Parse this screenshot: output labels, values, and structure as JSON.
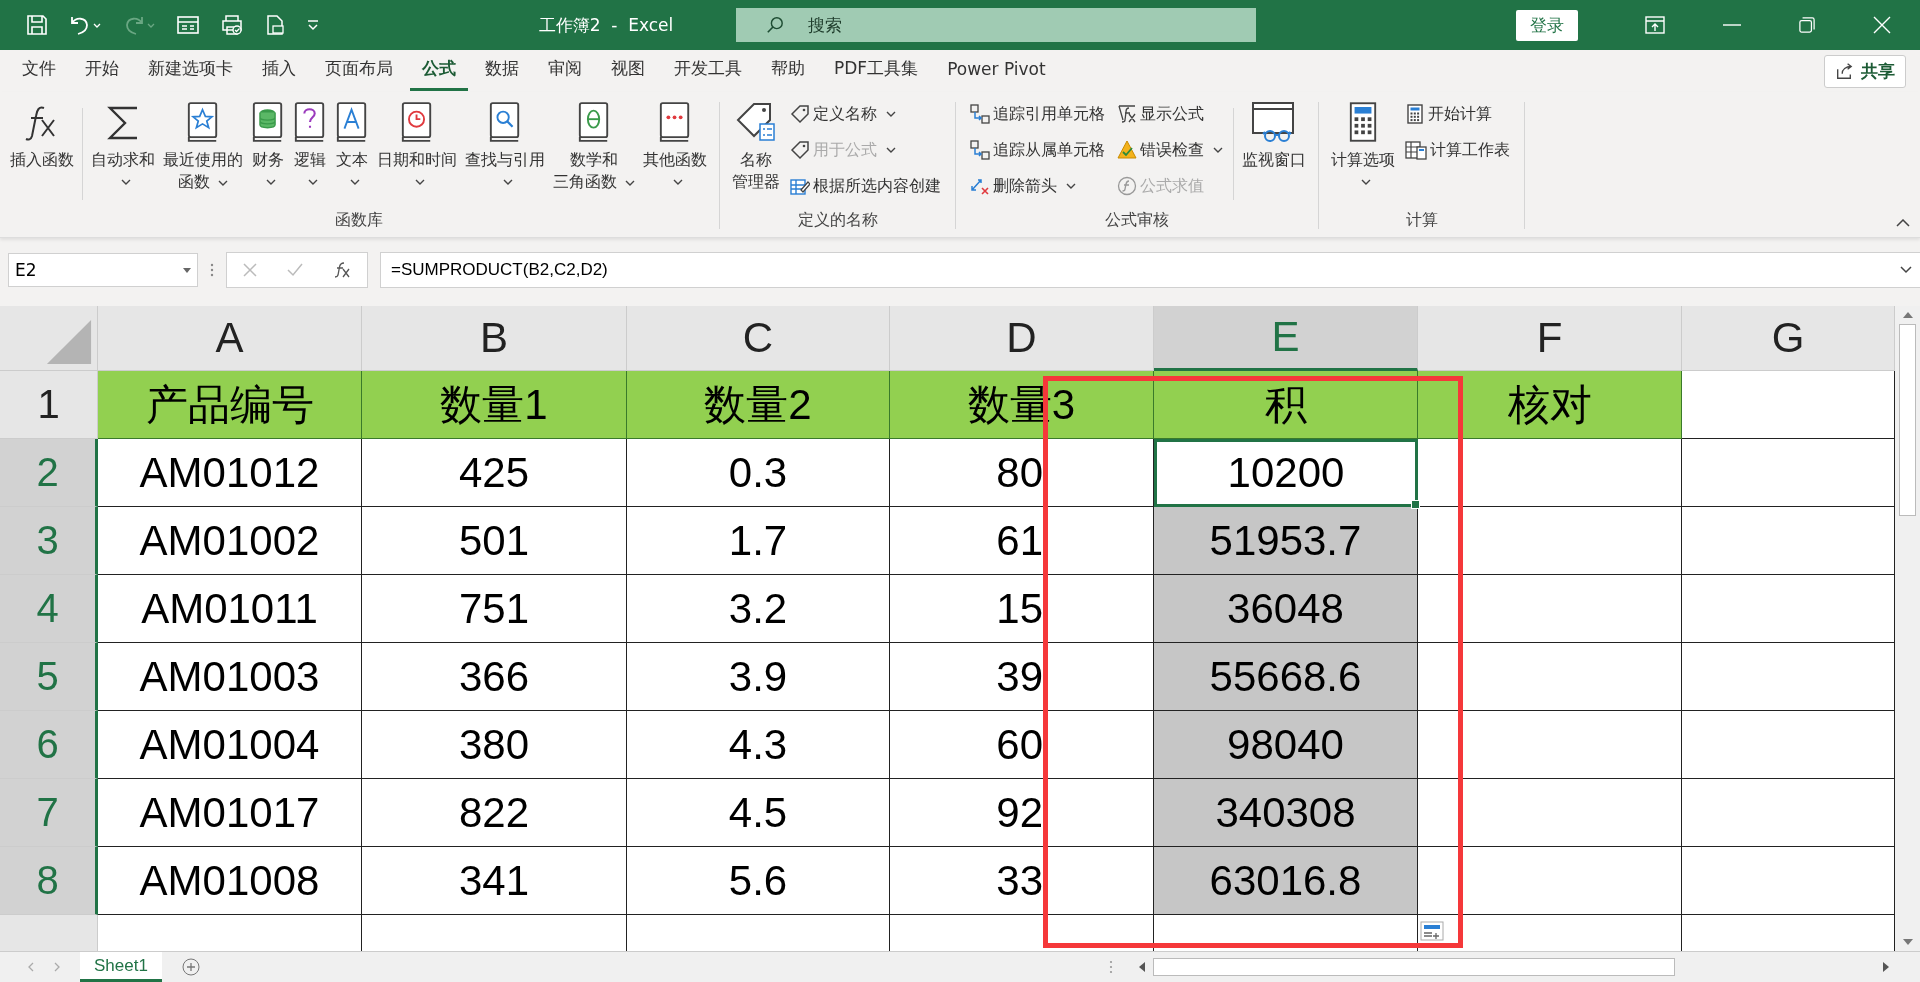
{
  "title_bar": {
    "title": "工作簿2  -  Excel",
    "search": {
      "placeholder": "搜索"
    },
    "sign_in": "登录"
  },
  "menu_tabs": [
    {
      "label": "文件",
      "selected": false
    },
    {
      "label": "开始",
      "selected": false
    },
    {
      "label": "新建选项卡",
      "selected": false
    },
    {
      "label": "插入",
      "selected": false
    },
    {
      "label": "页面布局",
      "selected": false
    },
    {
      "label": "公式",
      "selected": true
    },
    {
      "label": "数据",
      "selected": false
    },
    {
      "label": "审阅",
      "selected": false
    },
    {
      "label": "视图",
      "selected": false
    },
    {
      "label": "开发工具",
      "selected": false
    },
    {
      "label": "帮助",
      "selected": false
    },
    {
      "label": "PDF工具集",
      "selected": false
    },
    {
      "label": "Power Pivot",
      "selected": false
    }
  ],
  "share": "共享",
  "ribbon_groups": [
    {
      "label": "函数库",
      "columns": [
        {
          "kind": "large",
          "items": [
            {
              "lines": [
                "插入函数"
              ],
              "dropdown": false,
              "disabled": false
            }
          ]
        },
        {
          "kind": "separator"
        },
        {
          "kind": "large",
          "items": [
            {
              "lines": [
                "自动求和"
              ],
              "dropdown": true,
              "disabled": false
            }
          ]
        },
        {
          "kind": "large",
          "items": [
            {
              "lines": [
                "最近使用的",
                "函数"
              ],
              "dropdown": true,
              "disabled": false
            }
          ]
        },
        {
          "kind": "large",
          "items": [
            {
              "lines": [
                "财务"
              ],
              "dropdown": true,
              "disabled": false
            }
          ]
        },
        {
          "kind": "large",
          "items": [
            {
              "lines": [
                "逻辑"
              ],
              "dropdown": true,
              "disabled": false
            }
          ]
        },
        {
          "kind": "large",
          "items": [
            {
              "lines": [
                "文本"
              ],
              "dropdown": true,
              "disabled": false
            }
          ]
        },
        {
          "kind": "large",
          "items": [
            {
              "lines": [
                "日期和时间"
              ],
              "dropdown": true,
              "disabled": false
            }
          ]
        },
        {
          "kind": "large",
          "items": [
            {
              "lines": [
                "查找与引用"
              ],
              "dropdown": true,
              "disabled": false
            }
          ]
        },
        {
          "kind": "large",
          "items": [
            {
              "lines": [
                "数学和",
                "三角函数"
              ],
              "dropdown": true,
              "disabled": false
            }
          ]
        },
        {
          "kind": "large",
          "items": [
            {
              "lines": [
                "其他函数"
              ],
              "dropdown": true,
              "disabled": false
            }
          ]
        }
      ]
    },
    {
      "label": "定义的名称",
      "columns": [
        {
          "kind": "large",
          "items": [
            {
              "lines": [
                "名称",
                "管理器"
              ],
              "dropdown": false,
              "disabled": false
            }
          ]
        },
        {
          "kind": "small",
          "items": [
            {
              "lines": [
                "定义名称"
              ],
              "dropdown": true,
              "disabled": false
            },
            {
              "lines": [
                "用于公式"
              ],
              "dropdown": true,
              "disabled": true
            },
            {
              "lines": [
                "根据所选内容创建"
              ],
              "dropdown": false,
              "disabled": false
            }
          ]
        }
      ]
    },
    {
      "label": "公式审核",
      "columns": [
        {
          "kind": "small",
          "items": [
            {
              "lines": [
                "追踪引用单元格"
              ],
              "dropdown": false,
              "disabled": false
            },
            {
              "lines": [
                "追踪从属单元格"
              ],
              "dropdown": false,
              "disabled": false
            },
            {
              "lines": [
                "删除箭头"
              ],
              "dropdown": true,
              "disabled": false
            }
          ]
        },
        {
          "kind": "small",
          "items": [
            {
              "lines": [
                "显示公式"
              ],
              "dropdown": false,
              "disabled": false
            },
            {
              "lines": [
                "错误检查"
              ],
              "dropdown": true,
              "disabled": false
            },
            {
              "lines": [
                "公式求值"
              ],
              "dropdown": false,
              "disabled": true
            }
          ]
        },
        {
          "kind": "separator"
        },
        {
          "kind": "large",
          "items": [
            {
              "lines": [
                "监视窗口"
              ],
              "dropdown": false,
              "disabled": false
            }
          ]
        }
      ]
    },
    {
      "label": "计算",
      "columns": [
        {
          "kind": "large",
          "items": [
            {
              "lines": [
                "计算选项"
              ],
              "dropdown": true,
              "disabled": false
            }
          ]
        },
        {
          "kind": "small",
          "items": [
            {
              "lines": [
                "开始计算"
              ],
              "dropdown": false,
              "disabled": false
            },
            {
              "lines": [
                "计算工作表"
              ],
              "dropdown": false,
              "disabled": false
            }
          ]
        }
      ]
    }
  ],
  "formula_bar": {
    "name_box": "E2",
    "formula": "=SUMPRODUCT(B2,C2,D2)"
  },
  "columns": [
    {
      "label": "A",
      "selected": false
    },
    {
      "label": "B",
      "selected": false
    },
    {
      "label": "C",
      "selected": false
    },
    {
      "label": "D",
      "selected": false
    },
    {
      "label": "E",
      "selected": true
    },
    {
      "label": "F",
      "selected": false
    },
    {
      "label": "G",
      "selected": false
    }
  ],
  "rows": [
    {
      "number": "1",
      "kind": "header",
      "selected": false,
      "active": false,
      "cells": [
        "产品编号",
        "数量1",
        "数量2",
        "数量3",
        "积",
        "核对"
      ]
    },
    {
      "number": "2",
      "kind": "data",
      "selected": true,
      "active": true,
      "cells": [
        "AM01012",
        "425",
        "0.3",
        "80",
        "10200"
      ]
    },
    {
      "number": "3",
      "kind": "data",
      "selected": true,
      "active": false,
      "cells": [
        "AM01002",
        "501",
        "1.7",
        "61",
        "51953.7"
      ]
    },
    {
      "number": "4",
      "kind": "data",
      "selected": true,
      "active": false,
      "cells": [
        "AM01011",
        "751",
        "3.2",
        "15",
        "36048"
      ]
    },
    {
      "number": "5",
      "kind": "data",
      "selected": true,
      "active": false,
      "cells": [
        "AM01003",
        "366",
        "3.9",
        "39",
        "55668.6"
      ]
    },
    {
      "number": "6",
      "kind": "data",
      "selected": true,
      "active": false,
      "cells": [
        "AM01004",
        "380",
        "4.3",
        "60",
        "98040"
      ]
    },
    {
      "number": "7",
      "kind": "data",
      "selected": true,
      "active": false,
      "cells": [
        "AM01017",
        "822",
        "4.5",
        "92",
        "340308"
      ]
    },
    {
      "number": "8",
      "kind": "data",
      "selected": true,
      "active": false,
      "cells": [
        "AM01008",
        "341",
        "5.6",
        "33",
        "63016.8"
      ]
    }
  ],
  "sheet_tabs": [
    {
      "label": "Sheet1",
      "selected": true
    }
  ]
}
